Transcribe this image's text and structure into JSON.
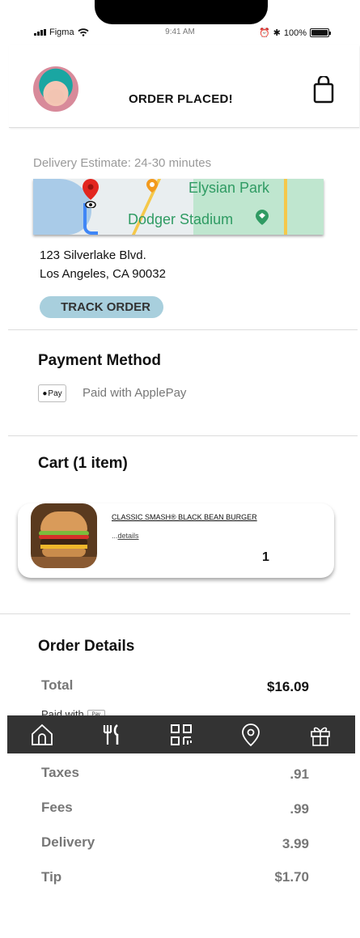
{
  "status_bar": {
    "carrier": "Figma",
    "time": "9:41 AM",
    "battery": "100%",
    "battery_level": 1.0
  },
  "header": {
    "title": "ORDER PLACED!",
    "avatar_icon": "user-avatar",
    "bag_icon": "shopping-bag-icon"
  },
  "delivery": {
    "estimate": "Delivery Estimate: 24-30  minutes",
    "map_labels": {
      "elysian": "Elysian Park",
      "dodger": "Dodger Stadium"
    },
    "address_line1": "123 Silverlake Blvd.",
    "address_line2": "Los Angeles, CA 90032",
    "track_button": "TRACK ORDER"
  },
  "payment": {
    "title": "Payment Method",
    "badge": "Pay",
    "label": "Paid with ApplePay"
  },
  "cart": {
    "title": "Cart (1 item)",
    "items": [
      {
        "name": "CLASSIC SMASH® BLACK BEAN BURGER",
        "details_prefix": "...",
        "details_link": "details",
        "quantity": "1"
      }
    ]
  },
  "order_details": {
    "title": "Order Details",
    "total_label": "Total",
    "total_value": "$16.09",
    "paid_with_peek": "Paid with",
    "peek_badge": "Pay",
    "rows": [
      {
        "label": "Taxes",
        "value": ".91"
      },
      {
        "label": "Fees",
        "value": ".99"
      },
      {
        "label": "Delivery",
        "value": "3.99"
      },
      {
        "label": "Tip",
        "value": "$1.70"
      }
    ]
  },
  "tab_bar": {
    "items": [
      {
        "icon": "home-icon"
      },
      {
        "icon": "fork-knife-icon"
      },
      {
        "icon": "qr-code-icon"
      },
      {
        "icon": "location-pin-icon"
      },
      {
        "icon": "gift-icon"
      }
    ]
  },
  "colors": {
    "track_button_bg": "#a8cfdd",
    "tab_bar_bg": "#333333",
    "map_park_green": "#2f9b63"
  }
}
